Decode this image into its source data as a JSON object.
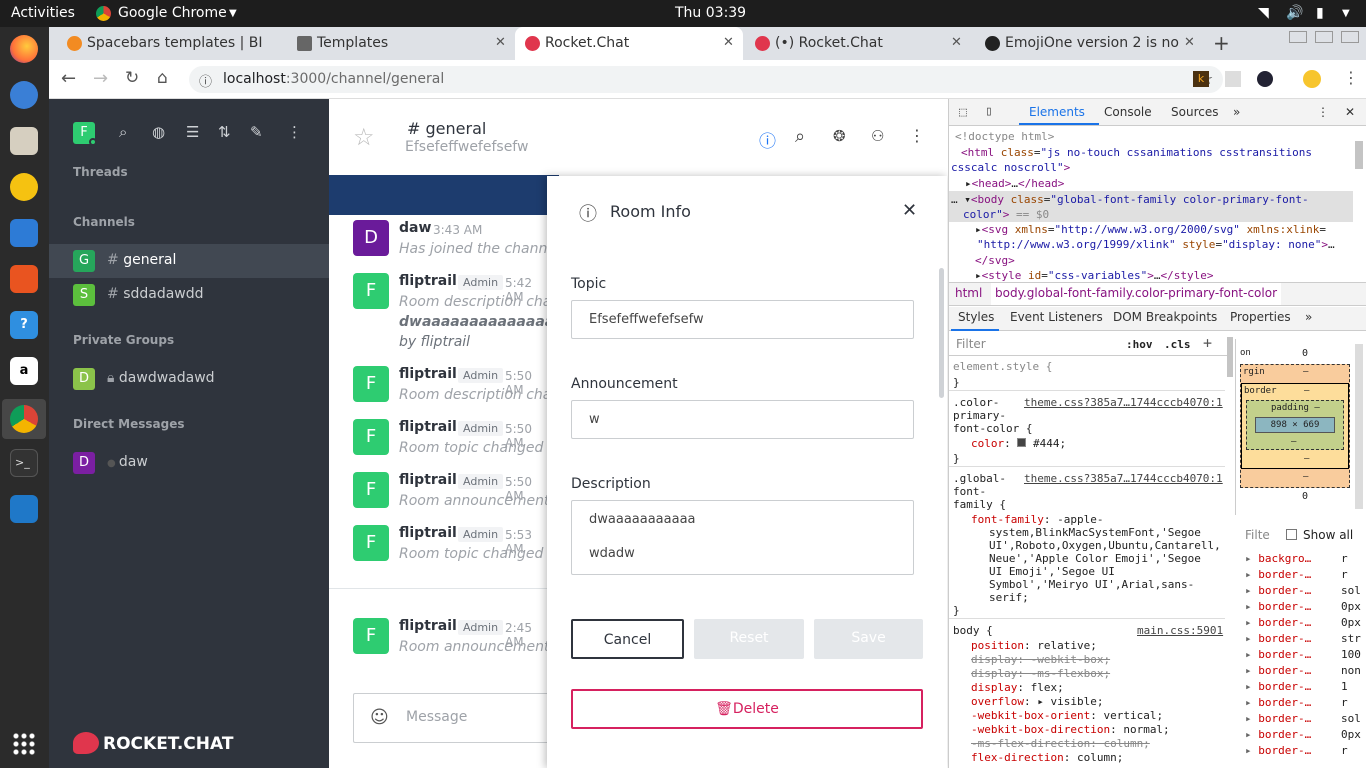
{
  "topbar": {
    "activities": "Activities",
    "app": "Google Chrome",
    "clock": "Thu 03:39"
  },
  "dock": {
    "icons": [
      "firefox-icon",
      "thunderbird-icon",
      "files-icon",
      "rhythmbox-icon",
      "writer-icon",
      "software-icon",
      "help-icon",
      "amazon-icon",
      "chrome-icon",
      "terminal-icon",
      "vscode-icon",
      "apps-grid-icon"
    ]
  },
  "browser": {
    "tabs": [
      {
        "label": "Spacebars templates | BI",
        "active": false
      },
      {
        "label": "Templates",
        "active": false
      },
      {
        "label": "Rocket.Chat",
        "active": true
      },
      {
        "label": "(•) Rocket.Chat",
        "active": false
      },
      {
        "label": "EmojiOne version 2 is no",
        "active": false
      }
    ],
    "url_host": "localhost",
    "url_path": ":3000/channel/general"
  },
  "sidebar": {
    "user_initial": "F",
    "threads": "Threads",
    "channels_title": "Channels",
    "channels": [
      {
        "initial": "G",
        "name": "general",
        "color": "#26a65b"
      },
      {
        "initial": "S",
        "name": "sddadawdd",
        "color": "#5cbf3d"
      }
    ],
    "private_title": "Private Groups",
    "private": [
      {
        "initial": "D",
        "name": "dawdwadawd",
        "color": "#8bc34a"
      }
    ],
    "dm_title": "Direct Messages",
    "dms": [
      {
        "initial": "D",
        "name": "daw",
        "color": "#7b1fa2"
      }
    ],
    "logo": "ROCKET.CHAT"
  },
  "room": {
    "name": "general",
    "topic": "Efsefeffwefefsefw"
  },
  "messages": [
    {
      "initial": "D",
      "user": "daw",
      "role": "",
      "time": "3:43 AM",
      "text": "Has joined the channel.",
      "color": "#6a1b9a"
    },
    {
      "initial": "F",
      "user": "fliptrail",
      "role": "Admin",
      "time": "5:42 AM",
      "text": "Room description chang",
      "extra1": "dwaaaaaaaaaaaaaaaa",
      "extra2": "by fliptrail",
      "color": "#2ecc71"
    },
    {
      "initial": "F",
      "user": "fliptrail",
      "role": "Admin",
      "time": "5:50 AM",
      "text": "Room description chang",
      "color": "#2ecc71"
    },
    {
      "initial": "F",
      "user": "fliptrail",
      "role": "Admin",
      "time": "5:50 AM",
      "text": "Room topic changed to:",
      "color": "#2ecc71"
    },
    {
      "initial": "F",
      "user": "fliptrail",
      "role": "Admin",
      "time": "5:50 AM",
      "text": "Room announcement ch",
      "color": "#2ecc71"
    },
    {
      "initial": "F",
      "user": "fliptrail",
      "role": "Admin",
      "time": "5:53 AM",
      "text": "Room topic changed to:",
      "color": "#2ecc71"
    },
    {
      "initial": "F",
      "user": "fliptrail",
      "role": "Admin",
      "time": "2:45 AM",
      "text": "Room announcement ch",
      "color": "#2ecc71"
    }
  ],
  "composer": {
    "placeholder": "Message"
  },
  "modal": {
    "title": "Room Info",
    "topic_label": "Topic",
    "topic_value": "Efsefeffwefefsefw",
    "announcement_label": "Announcement",
    "announcement_value": "w",
    "description_label": "Description",
    "description_line1": "dwaaaaaaaaaaa",
    "description_line2": "wdadw",
    "cancel": "Cancel",
    "reset": "Reset",
    "save": "Save",
    "delete": "Delete"
  },
  "devtools": {
    "tabs": [
      "Elements",
      "Console",
      "Sources"
    ],
    "crumbs": [
      "html",
      "body.global-font-family.color-primary-font-color"
    ],
    "style_tabs": [
      "Styles",
      "Event Listeners",
      "DOM Breakpoints",
      "Properties"
    ],
    "filter": "Filter",
    "hov": ":hov",
    "cls": ".cls",
    "box_size": "898 × 669",
    "filte": "Filte",
    "show_all": "Show all",
    "computed": [
      "backgro…",
      "border-…",
      "border-…",
      "border-…",
      "border-…",
      "border-…",
      "border-…",
      "border-…",
      "border-…",
      "border-…",
      "border-…",
      "border-…",
      "border-…"
    ],
    "computed_vals": [
      "r",
      "r",
      "sol",
      "0px",
      "0px",
      "str",
      "100",
      "non",
      "1",
      "r",
      "sol",
      "0px",
      "r"
    ]
  }
}
